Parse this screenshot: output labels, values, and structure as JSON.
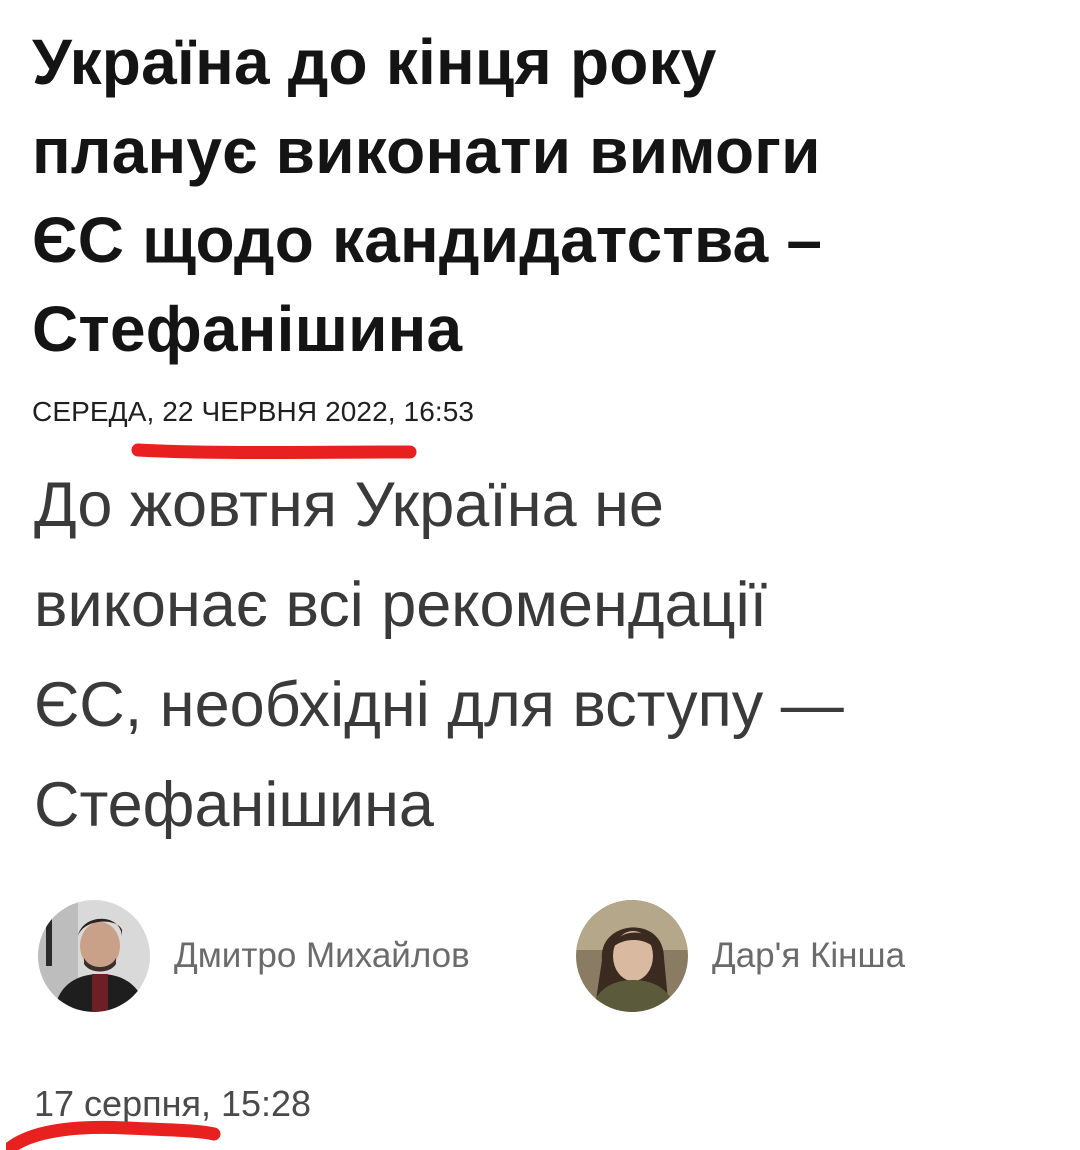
{
  "article_1": {
    "headline_lines": [
      "Україна до кінця року",
      "планує виконати вимоги",
      "ЄС щодо кандидатства –",
      "Стефанішина"
    ],
    "date": "СЕРЕДА, 22 ЧЕРВНЯ 2022, 16:53"
  },
  "article_2": {
    "headline_lines": [
      "До жовтня Україна не",
      "виконає всі рекомендації",
      "ЄС, необхідні для вступу —",
      "Стефанішина"
    ],
    "authors": [
      {
        "name": "Дмитро Михайлов",
        "avatar_icon": "author-photo-man"
      },
      {
        "name": "Дар'я Кінша",
        "avatar_icon": "author-photo-woman"
      }
    ],
    "date": "17 серпня, 15:28"
  },
  "colors": {
    "annotation_red": "#e8201f",
    "headline_text": "#141414",
    "subheadline_text": "#3a3a3a",
    "author_text": "#6b6b6b"
  }
}
